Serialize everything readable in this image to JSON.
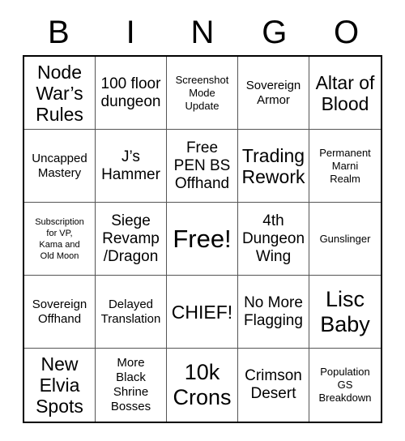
{
  "card": {
    "title": "BINGO",
    "header_letters": [
      "B",
      "I",
      "N",
      "G",
      "O"
    ],
    "columns": 5,
    "rows": 5,
    "free_space_index": 12,
    "colors": {
      "background": "#ffffff",
      "text": "#000000",
      "outer_border": "#000000",
      "inner_border": "#555555"
    },
    "cells": [
      {
        "text": "Node\nWar’s\nRules",
        "size": "lg"
      },
      {
        "text": "100 floor\ndungeon",
        "size": "md"
      },
      {
        "text": "Screenshot\nMode\nUpdate",
        "size": "xs"
      },
      {
        "text": "Sovereign\nArmor",
        "size": "sm"
      },
      {
        "text": "Altar of\nBlood",
        "size": "lg"
      },
      {
        "text": "Uncapped\nMastery",
        "size": "sm"
      },
      {
        "text": "J’s\nHammer",
        "size": "md"
      },
      {
        "text": "Free\nPEN BS\nOffhand",
        "size": "md"
      },
      {
        "text": "Trading\nRework",
        "size": "lg"
      },
      {
        "text": "Permanent\nMarni\nRealm",
        "size": "xs"
      },
      {
        "text": "Subscription\nfor VP,\nKama and\nOld Moon",
        "size": "xxs"
      },
      {
        "text": "Siege\nRevamp\n/Dragon",
        "size": "md"
      },
      {
        "text": "Free!",
        "size": "xxl"
      },
      {
        "text": "4th\nDungeon\nWing",
        "size": "md"
      },
      {
        "text": "Gunslinger",
        "size": "xs"
      },
      {
        "text": "Sovereign\nOffhand",
        "size": "sm"
      },
      {
        "text": "Delayed\nTranslation",
        "size": "sm"
      },
      {
        "text": "CHIEF!",
        "size": "lg"
      },
      {
        "text": "No More\nFlagging",
        "size": "md"
      },
      {
        "text": "Lisc\nBaby",
        "size": "xl"
      },
      {
        "text": "New\nElvia\nSpots",
        "size": "lg"
      },
      {
        "text": "More\nBlack\nShrine\nBosses",
        "size": "sm"
      },
      {
        "text": "10k\nCrons",
        "size": "xl"
      },
      {
        "text": "Crimson\nDesert",
        "size": "md"
      },
      {
        "text": "Population\nGS\nBreakdown",
        "size": "xs"
      }
    ]
  }
}
